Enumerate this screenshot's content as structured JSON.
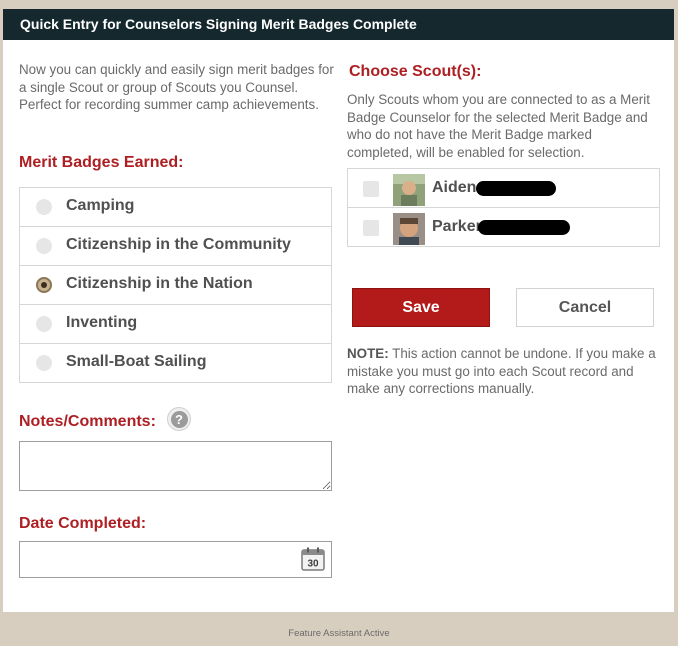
{
  "dialog": {
    "title": "Quick Entry for Counselors Signing Merit Badges Complete"
  },
  "intro": "Now you can quickly and easily sign merit badges for a single Scout or group of Scouts you Counsel. Perfect for recording summer camp achievements.",
  "merit_badges": {
    "label": "Merit Badges Earned:",
    "selected": "Citizenship in the Nation",
    "items": [
      {
        "label": "Camping",
        "checked": false
      },
      {
        "label": "Citizenship in the Community",
        "checked": false
      },
      {
        "label": "Citizenship in the Nation",
        "checked": true
      },
      {
        "label": "Inventing",
        "checked": false
      },
      {
        "label": "Small-Boat Sailing",
        "checked": false
      }
    ]
  },
  "notes": {
    "label": "Notes/Comments:",
    "help_icon": "question-mark-icon",
    "value": ""
  },
  "date": {
    "label": "Date Completed:",
    "value": "",
    "calendar_icon_text": "30"
  },
  "scouts": {
    "label": "Choose Scout(s):",
    "description": "Only Scouts whom you are connected to as a Merit Badge Counselor for the selected Merit Badge and who do not have the Merit Badge marked completed, will be enabled for selection.",
    "items": [
      {
        "name": "Aiden",
        "checked": false
      },
      {
        "name": "Parker",
        "checked": false
      }
    ]
  },
  "buttons": {
    "save": "Save",
    "cancel": "Cancel"
  },
  "note": {
    "prefix": "NOTE:",
    "text": " This action cannot be undone. If you make a mistake you must go into each Scout record and make any corrections manually."
  },
  "footer": "Feature Assistant Active",
  "colors": {
    "titlebar": "#14282e",
    "accent_red": "#ad1f23",
    "save_button": "#b31b1b",
    "page_background": "#d8cebf"
  }
}
